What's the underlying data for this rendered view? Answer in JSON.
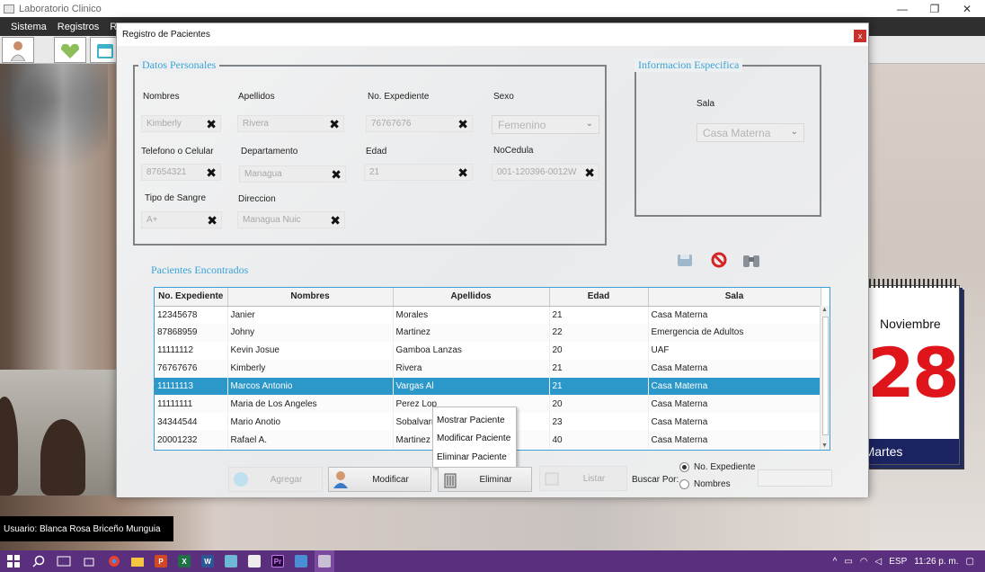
{
  "window": {
    "title": "Laboratorio Clinico",
    "minimize": "—",
    "restore": "❐",
    "close": "✕"
  },
  "menu": [
    "Sistema",
    "Registros",
    "Re"
  ],
  "background": {
    "user_label": "Usuario: Blanca Rosa Briceño Munguia"
  },
  "calendar": {
    "month": "Noviembre",
    "day": "28",
    "weekday": "Martes"
  },
  "dialog": {
    "title": "Registro de Pacientes",
    "close": "x",
    "datos_personales": {
      "title": "Datos Personales",
      "nombres": {
        "label": "Nombres",
        "value": "Kimberly"
      },
      "apellidos": {
        "label": "Apellidos",
        "value": "Rivera"
      },
      "expediente": {
        "label": "No. Expediente",
        "value": "76767676"
      },
      "sexo": {
        "label": "Sexo",
        "value": "Femenino"
      },
      "telefono": {
        "label": "Telefono o Celular",
        "value": "87654321"
      },
      "departamento": {
        "label": "Departamento",
        "value": "Managua"
      },
      "edad": {
        "label": "Edad",
        "value": "21"
      },
      "cedula": {
        "label": "NoCedula",
        "value": "001-120396-0012W"
      },
      "sangre": {
        "label": "Tipo de Sangre",
        "value": "A+"
      },
      "direccion": {
        "label": "Direccion",
        "value": "Managua Nuic"
      },
      "clear_glyph": "✖"
    },
    "info_especifica": {
      "title": "Informacion Especifica",
      "sala": {
        "label": "Sala",
        "value": "Casa Materna"
      }
    },
    "pacientes": {
      "title": "Pacientes Encontrados",
      "columns": [
        "No. Expediente",
        "Nombres",
        "Apellidos",
        "Edad",
        "Sala"
      ],
      "rows": [
        [
          "12345678",
          "Janier",
          "Morales",
          "21",
          "Casa Materna"
        ],
        [
          "87868959",
          "Johny",
          "Martinez",
          "22",
          "Emergencia de Adultos"
        ],
        [
          "11111112",
          "Kevin Josue",
          "Gamboa Lanzas",
          "20",
          "UAF"
        ],
        [
          "76767676",
          "Kimberly",
          "Rivera",
          "21",
          "Casa Materna"
        ],
        [
          "11111113",
          "Marcos Antonio",
          "Vargas Al",
          "21",
          "Casa Materna"
        ],
        [
          "11111111",
          "Maria de Los Angeles",
          "Perez Lop",
          "20",
          "Casa Materna"
        ],
        [
          "34344544",
          "Mario Anotio",
          "Sobalvarr",
          "23",
          "Casa Materna"
        ],
        [
          "20001232",
          "Rafael A.",
          "Martinez",
          "40",
          "Casa Materna"
        ]
      ],
      "selected_row": 4
    },
    "context_menu": [
      "Mostrar Paciente",
      "Modificar Paciente",
      "Eliminar Paciente"
    ],
    "buttons": {
      "agregar": "Agregar",
      "modificar": "Modificar",
      "eliminar": "Eliminar",
      "listar": "Listar"
    },
    "buscar": {
      "label": "Buscar Por:",
      "option1": "No. Expediente",
      "option2": "Nombres",
      "selected": "No. Expediente"
    }
  },
  "taskbar": {
    "apps": [
      "P",
      "X",
      "W",
      "Pr"
    ],
    "language": "ESP",
    "time": "11:26 p. m."
  }
}
